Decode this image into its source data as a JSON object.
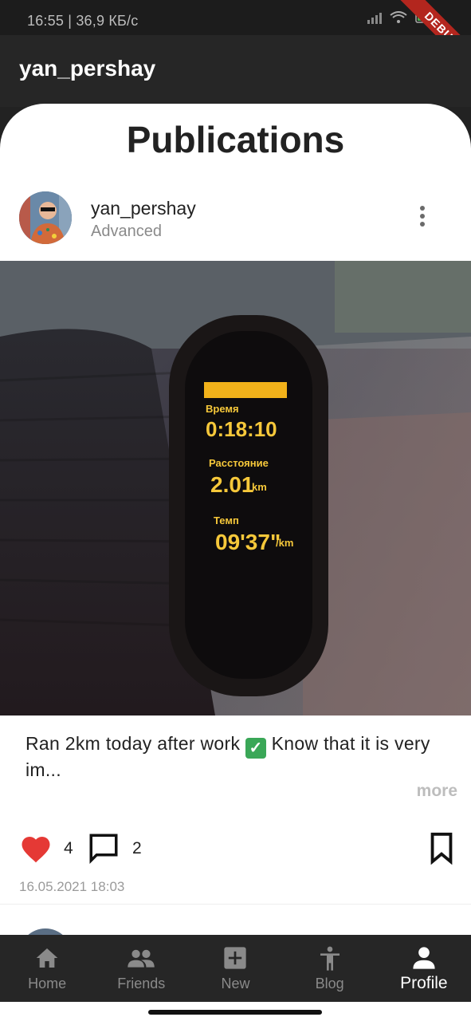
{
  "status_bar": {
    "time": "16:55 | 36,9 КБ/с",
    "debug_banner": "DEBUG"
  },
  "app_bar": {
    "title": "yan_pershay"
  },
  "page": {
    "title": "Publications"
  },
  "post": {
    "username": "yan_pershay",
    "level": "Advanced",
    "caption": "Ran 2km today after work",
    "caption_rest": " Know that it is very im...",
    "check_icon": "check-mark-emoji",
    "more_label": "more",
    "likes_count": "4",
    "comments_count": "2",
    "date": "16.05.2021 18:03",
    "watch_screen": {
      "time_label": "Время",
      "time": "0:18:10",
      "distance_label": "Расстояние",
      "distance": "2.01",
      "distance_unit": "km",
      "pace_label": "Темп",
      "pace": "09'37\"",
      "pace_unit": "/km"
    }
  },
  "bottom_nav": {
    "items": [
      {
        "label": "Home",
        "icon": "home-icon"
      },
      {
        "label": "Friends",
        "icon": "people-icon"
      },
      {
        "label": "New",
        "icon": "add-box-icon"
      },
      {
        "label": "Blog",
        "icon": "accessibility-icon"
      },
      {
        "label": "Profile",
        "icon": "person-icon"
      }
    ],
    "active": "Profile"
  },
  "colors": {
    "heart": "#e53935",
    "nav_bg": "#262626",
    "active_label": "#ffffff",
    "inactive_label": "#8a8a8a"
  }
}
